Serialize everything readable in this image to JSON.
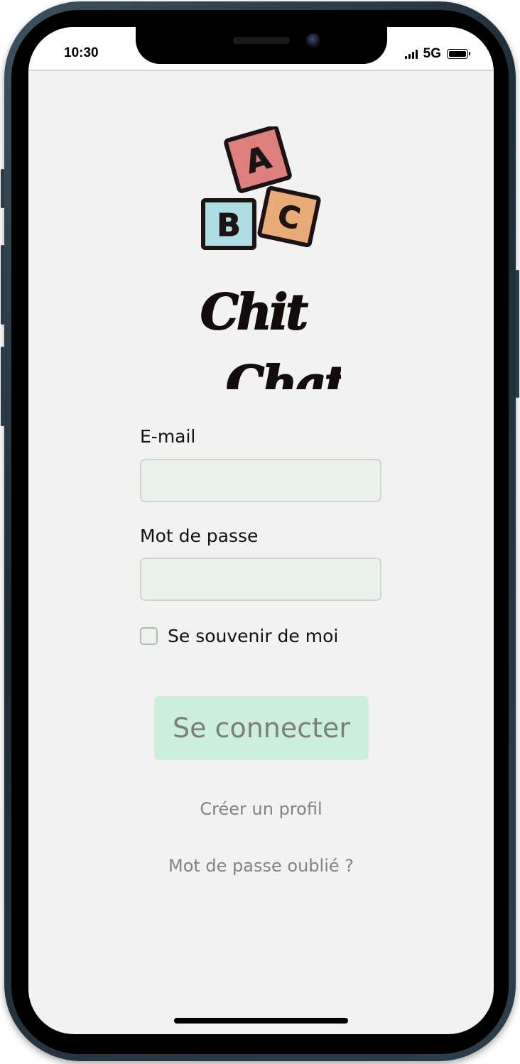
{
  "status_bar": {
    "time": "10:30",
    "network": "5G"
  },
  "app": {
    "logo_blocks": [
      "A",
      "B",
      "C"
    ],
    "logo_word_1": "Chit",
    "logo_word_2": "Chat",
    "block_colors": {
      "a": "#dd7f7d",
      "b": "#aedde3",
      "c": "#e9ac78"
    }
  },
  "form": {
    "email_label": "E-mail",
    "email_value": "",
    "password_label": "Mot de passe",
    "password_value": "",
    "remember_label": "Se souvenir de moi",
    "remember_checked": false,
    "submit_label": "Se connecter"
  },
  "links": {
    "create_profile": "Créer un profil",
    "forgot_password": "Mot de passe oublié ?"
  },
  "colors": {
    "screen_bg": "#f3f2f3",
    "input_bg": "#e9f2ea",
    "button_bg": "#ccefdb",
    "link_text": "#838383"
  }
}
